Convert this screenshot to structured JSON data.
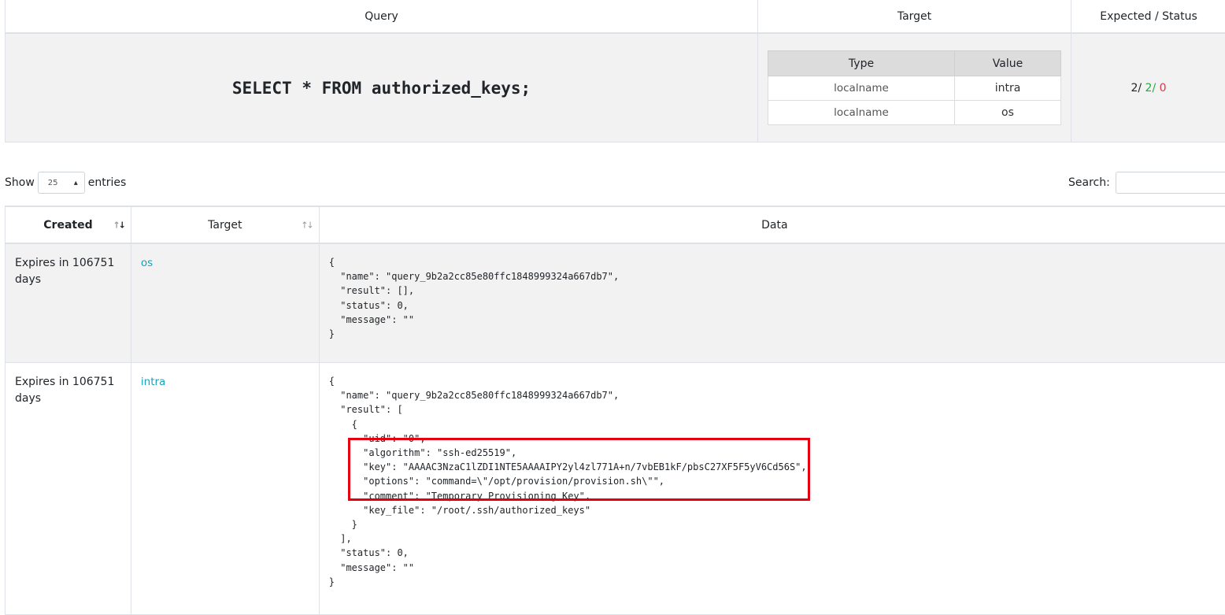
{
  "query_table": {
    "headers": {
      "query": "Query",
      "target": "Target",
      "status": "Expected / Status"
    },
    "sql": "SELECT * FROM authorized_keys;",
    "target_sub": {
      "headers": {
        "type": "Type",
        "value": "Value"
      },
      "rows": [
        {
          "type": "localname",
          "value": "intra"
        },
        {
          "type": "localname",
          "value": "os"
        }
      ]
    },
    "status": {
      "expected": "2/",
      "success": "2/",
      "failed": "0"
    }
  },
  "controls": {
    "show_label": "Show",
    "entries_value": "25",
    "entries_label": "entries",
    "search_label": "Search:",
    "search_value": ""
  },
  "results": {
    "headers": {
      "created": "Created",
      "target": "Target",
      "data": "Data"
    },
    "rows": [
      {
        "created": "Expires in 106751 days",
        "target": "os",
        "data": "{\n  \"name\": \"query_9b2a2cc85e80ffc1848999324a667db7\",\n  \"result\": [],\n  \"status\": 0,\n  \"message\": \"\"\n}"
      },
      {
        "created": "Expires in 106751 days",
        "target": "intra",
        "data": "{\n  \"name\": \"query_9b2a2cc85e80ffc1848999324a667db7\",\n  \"result\": [\n    {\n      \"uid\": \"0\",\n      \"algorithm\": \"ssh-ed25519\",\n      \"key\": \"AAAAC3NzaC1lZDI1NTE5AAAAIPY2yl4zl771A+n/7vbEB1kF/pbsC27XF5F5yV6Cd56S\",\n      \"options\": \"command=\\\"/opt/provision/provision.sh\\\"\",\n      \"comment\": \"Temporary Provisioning Key\",\n      \"key_file\": \"/root/.ssh/authorized_keys\"\n    }\n  ],\n  \"status\": 0,\n  \"message\": \"\"\n}"
      }
    ]
  },
  "colors": {
    "success_green": "#28a745",
    "failed_red": "#dc3545",
    "link_teal": "#17a2b8",
    "highlight_red": "#e3000f"
  }
}
